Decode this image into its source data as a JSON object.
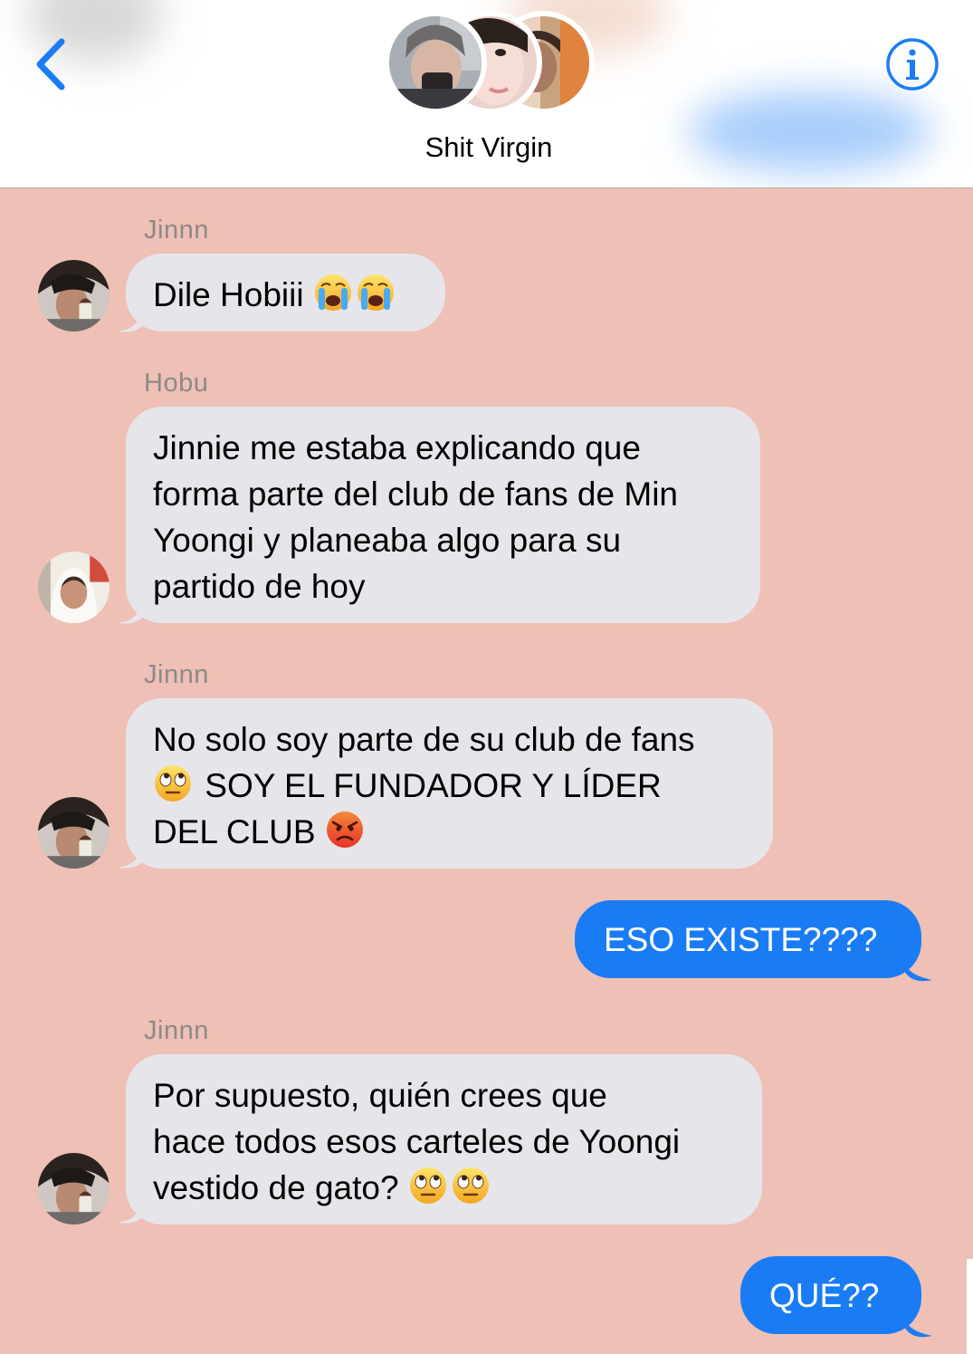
{
  "header": {
    "group_name": "Shit Virgin",
    "back_icon": "chevron-left-icon",
    "info_icon": "info-circle-icon",
    "accent_color": "#1a7cf5",
    "participant_avatar_count": 3
  },
  "messages": [
    {
      "direction": "incoming",
      "sender": "Jinnn",
      "lines": [
        "Dile Hobiii"
      ],
      "trailing_emoji": [
        "loudly-crying-face",
        "loudly-crying-face"
      ]
    },
    {
      "direction": "incoming",
      "sender": "Hobu",
      "lines": [
        "Jinnie me estaba explicando que",
        "forma parte del club de fans de Min",
        "Yoongi y planeaba algo para su",
        "partido de hoy"
      ]
    },
    {
      "direction": "incoming",
      "sender": "Jinnn",
      "lines": [
        "No solo soy parte de su club de fans",
        "SOY EL FUNDADOR Y LÍDER",
        "DEL CLUB"
      ],
      "inline_emoji": [
        "face-with-rolling-eyes",
        "angry-face"
      ]
    },
    {
      "direction": "outgoing",
      "text": "ESO EXISTE????"
    },
    {
      "direction": "incoming",
      "sender": "Jinnn",
      "lines": [
        "Por supuesto, quién crees que",
        "hace todos esos carteles de Yoongi",
        "vestido de gato?"
      ],
      "trailing_emoji": [
        "face-with-rolling-eyes",
        "face-with-rolling-eyes"
      ]
    },
    {
      "direction": "outgoing",
      "text": "QUÉ??"
    }
  ],
  "colors": {
    "background": "#efc0b5",
    "incoming_bubble": "#e6e5ea",
    "outgoing_bubble": "#1a7cf5",
    "sender_name": "#8d8988"
  }
}
